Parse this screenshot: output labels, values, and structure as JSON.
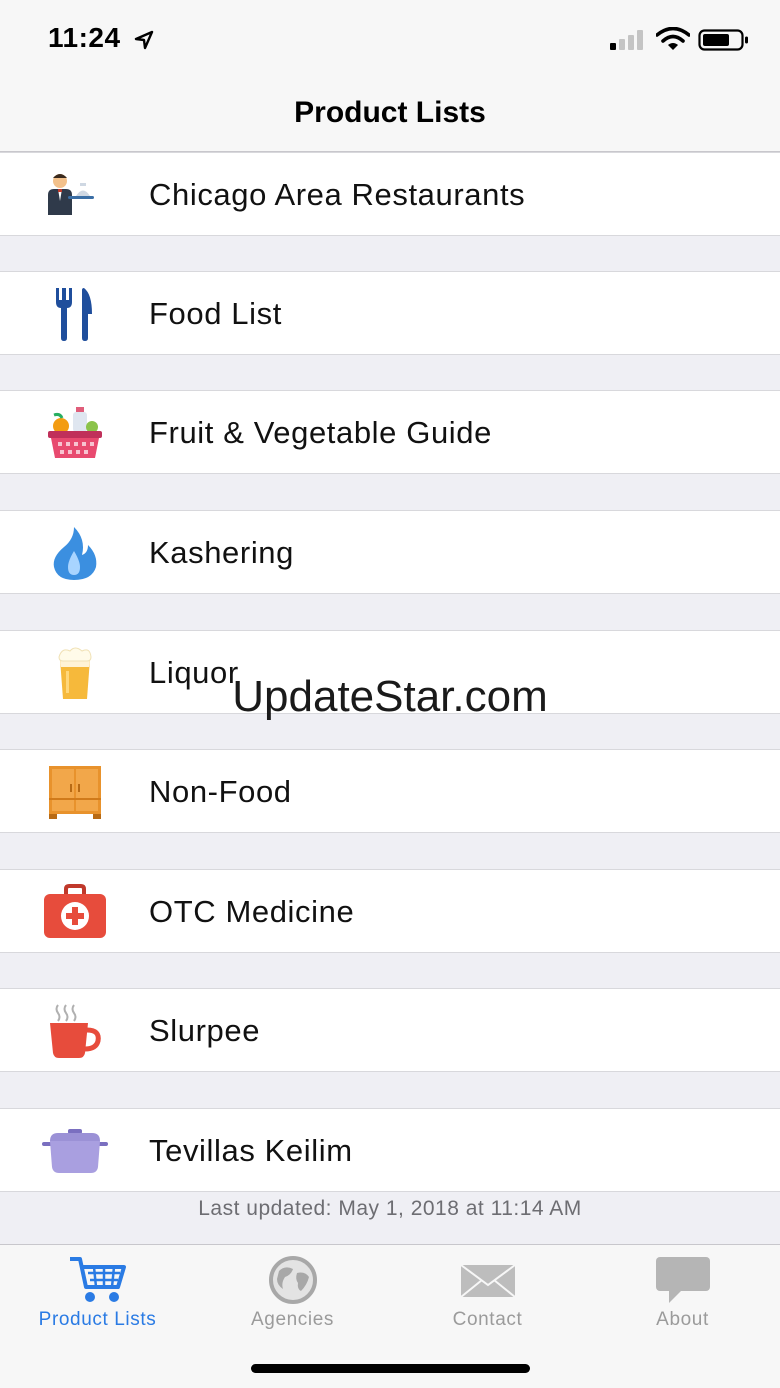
{
  "status_bar": {
    "time": "11:24"
  },
  "nav": {
    "title": "Product Lists"
  },
  "items": [
    {
      "label": "Chicago Area Restaurants",
      "icon": "waiter-icon"
    },
    {
      "label": "Food List",
      "icon": "fork-knife-icon"
    },
    {
      "label": "Fruit & Vegetable Guide",
      "icon": "grocery-basket-icon"
    },
    {
      "label": "Kashering",
      "icon": "flame-icon"
    },
    {
      "label": "Liquor",
      "icon": "beer-glass-icon"
    },
    {
      "label": "Non-Food",
      "icon": "cabinet-icon"
    },
    {
      "label": "OTC Medicine",
      "icon": "first-aid-kit-icon"
    },
    {
      "label": "Slurpee",
      "icon": "hot-cup-icon"
    },
    {
      "label": "Tevillas Keilim",
      "icon": "pot-icon"
    }
  ],
  "footer_note": "Last updated: May 1, 2018 at 11:14 AM",
  "watermark": "UpdateStar.com",
  "tabs": [
    {
      "label": "Product Lists",
      "icon": "cart-icon",
      "active": true
    },
    {
      "label": "Agencies",
      "icon": "globe-icon",
      "active": false
    },
    {
      "label": "Contact",
      "icon": "envelope-icon",
      "active": false
    },
    {
      "label": "About",
      "icon": "speech-bubble-icon",
      "active": false
    }
  ],
  "colors": {
    "accent": "#2a7be4",
    "inactive": "#9b9b9b",
    "background": "#efeff4"
  }
}
